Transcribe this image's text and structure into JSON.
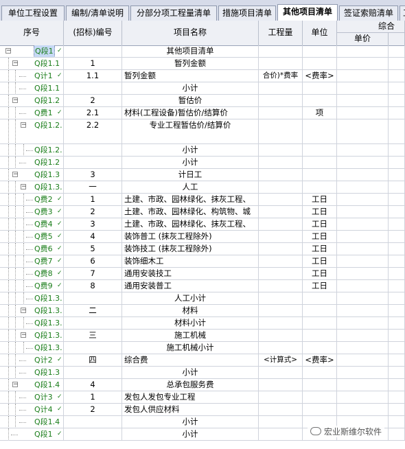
{
  "tabs": [
    {
      "label": "单位工程设置",
      "active": false
    },
    {
      "label": "编制/清单说明",
      "active": false
    },
    {
      "label": "分部分项工程量清单",
      "active": false
    },
    {
      "label": "措施项目清单",
      "active": false
    },
    {
      "label": "其他项目清单",
      "active": true
    },
    {
      "label": "签证索赔清单",
      "active": false
    },
    {
      "label": "工",
      "active": false
    }
  ],
  "columns": {
    "seq": "序号",
    "code": "(招标)编号",
    "name": "项目名称",
    "qty": "工程量",
    "unit": "单位",
    "group": "综合",
    "price": "单价"
  },
  "rows": [
    {
      "seq": "Q段1",
      "check": true,
      "code": "",
      "name": "其他项目清单",
      "center": true,
      "qty": "",
      "unit": "",
      "depth": 0,
      "toggle": "-",
      "selected": true
    },
    {
      "seq": "Q段1.1",
      "check": false,
      "code": "1",
      "name": "暂列金额",
      "center": true,
      "qty": "",
      "unit": "",
      "depth": 1,
      "toggle": "-"
    },
    {
      "seq": "Q计1",
      "check": true,
      "code": "1.1",
      "name": "暂列金额",
      "center": false,
      "qty": "合价)*费率",
      "unit": "<费率>",
      "depth": 2,
      "toggle": ""
    },
    {
      "seq": "Q段1.1",
      "check": false,
      "code": "",
      "name": "小计",
      "center": true,
      "qty": "",
      "unit": "",
      "depth": 2,
      "toggle": ""
    },
    {
      "seq": "Q段1.2",
      "check": false,
      "code": "2",
      "name": "暂估价",
      "center": true,
      "qty": "",
      "unit": "",
      "depth": 1,
      "toggle": "-"
    },
    {
      "seq": "Q费1",
      "check": true,
      "code": "2.1",
      "name": "材料(工程设备)暂估价/结算价",
      "center": false,
      "qty": "",
      "unit": "项",
      "depth": 2,
      "toggle": ""
    },
    {
      "seq": "Q段1.2.",
      "check": false,
      "code": "2.2",
      "name": "专业工程暂估价/结算价",
      "center": true,
      "qty": "",
      "unit": "",
      "depth": 2,
      "toggle": "-",
      "tall": true
    },
    {
      "seq": "Q段1.2.",
      "check": false,
      "code": "",
      "name": "小计",
      "center": true,
      "qty": "",
      "unit": "",
      "depth": 3,
      "toggle": ""
    },
    {
      "seq": "Q段1.2",
      "check": false,
      "code": "",
      "name": "小计",
      "center": true,
      "qty": "",
      "unit": "",
      "depth": 2,
      "toggle": ""
    },
    {
      "seq": "Q段1.3",
      "check": false,
      "code": "3",
      "name": "计日工",
      "center": true,
      "qty": "",
      "unit": "",
      "depth": 1,
      "toggle": "-"
    },
    {
      "seq": "Q段1.3.",
      "check": false,
      "code": "一",
      "name": "人工",
      "center": true,
      "qty": "",
      "unit": "",
      "depth": 2,
      "toggle": "-"
    },
    {
      "seq": "Q费2",
      "check": true,
      "code": "1",
      "name": "土建、市政、园林绿化、抹灰工程、",
      "center": false,
      "qty": "",
      "unit": "工日",
      "depth": 3,
      "toggle": ""
    },
    {
      "seq": "Q费3",
      "check": true,
      "code": "2",
      "name": "土建、市政、园林绿化、构筑物、城",
      "center": false,
      "qty": "",
      "unit": "工日",
      "depth": 3,
      "toggle": ""
    },
    {
      "seq": "Q费4",
      "check": true,
      "code": "3",
      "name": "土建、市政、园林绿化、抹灰工程、",
      "center": false,
      "qty": "",
      "unit": "工日",
      "depth": 3,
      "toggle": ""
    },
    {
      "seq": "Q费5",
      "check": true,
      "code": "4",
      "name": "装饰普工 (抹灰工程除外)",
      "center": false,
      "qty": "",
      "unit": "工日",
      "depth": 3,
      "toggle": ""
    },
    {
      "seq": "Q费6",
      "check": true,
      "code": "5",
      "name": "装饰技工 (抹灰工程除外)",
      "center": false,
      "qty": "",
      "unit": "工日",
      "depth": 3,
      "toggle": ""
    },
    {
      "seq": "Q费7",
      "check": true,
      "code": "6",
      "name": "装饰细木工",
      "center": false,
      "qty": "",
      "unit": "工日",
      "depth": 3,
      "toggle": ""
    },
    {
      "seq": "Q费8",
      "check": true,
      "code": "7",
      "name": "通用安装技工",
      "center": false,
      "qty": "",
      "unit": "工日",
      "depth": 3,
      "toggle": ""
    },
    {
      "seq": "Q费9",
      "check": true,
      "code": "8",
      "name": "通用安装普工",
      "center": false,
      "qty": "",
      "unit": "工日",
      "depth": 3,
      "toggle": ""
    },
    {
      "seq": "Q段1.3.",
      "check": false,
      "code": "",
      "name": "人工小计",
      "center": true,
      "qty": "",
      "unit": "",
      "depth": 3,
      "toggle": ""
    },
    {
      "seq": "Q段1.3.",
      "check": false,
      "code": "二",
      "name": "材料",
      "center": true,
      "qty": "",
      "unit": "",
      "depth": 2,
      "toggle": "-"
    },
    {
      "seq": "Q段1.3.",
      "check": false,
      "code": "",
      "name": "材料小计",
      "center": true,
      "qty": "",
      "unit": "",
      "depth": 3,
      "toggle": ""
    },
    {
      "seq": "Q段1.3.",
      "check": false,
      "code": "三",
      "name": "施工机械",
      "center": true,
      "qty": "",
      "unit": "",
      "depth": 2,
      "toggle": "-"
    },
    {
      "seq": "Q段1.3.",
      "check": false,
      "code": "",
      "name": "施工机械小计",
      "center": true,
      "qty": "",
      "unit": "",
      "depth": 3,
      "toggle": ""
    },
    {
      "seq": "Q计2",
      "check": true,
      "code": "四",
      "name": "综合费",
      "center": false,
      "qty": "<计算式>",
      "unit": "<费率>",
      "depth": 2,
      "toggle": ""
    },
    {
      "seq": "Q段1.3",
      "check": false,
      "code": "",
      "name": "小计",
      "center": true,
      "qty": "",
      "unit": "",
      "depth": 2,
      "toggle": ""
    },
    {
      "seq": "Q段1.4",
      "check": false,
      "code": "4",
      "name": "总承包服务费",
      "center": true,
      "qty": "",
      "unit": "",
      "depth": 1,
      "toggle": "-"
    },
    {
      "seq": "Q计3",
      "check": true,
      "code": "1",
      "name": "发包人发包专业工程",
      "center": false,
      "qty": "",
      "unit": "",
      "depth": 2,
      "toggle": ""
    },
    {
      "seq": "Q计4",
      "check": true,
      "code": "2",
      "name": "发包人供应材料",
      "center": false,
      "qty": "",
      "unit": "",
      "depth": 2,
      "toggle": ""
    },
    {
      "seq": "Q段1.4",
      "check": false,
      "code": "",
      "name": "小计",
      "center": true,
      "qty": "",
      "unit": "",
      "depth": 2,
      "toggle": ""
    },
    {
      "seq": "Q段1",
      "check": true,
      "code": "",
      "name": "小计",
      "center": true,
      "qty": "",
      "unit": "",
      "depth": 1,
      "toggle": ""
    }
  ],
  "watermark": "宏业斯维尔软件",
  "colors": {
    "seq_text": "#1a7d1a",
    "selection": "#c7d9f5"
  }
}
